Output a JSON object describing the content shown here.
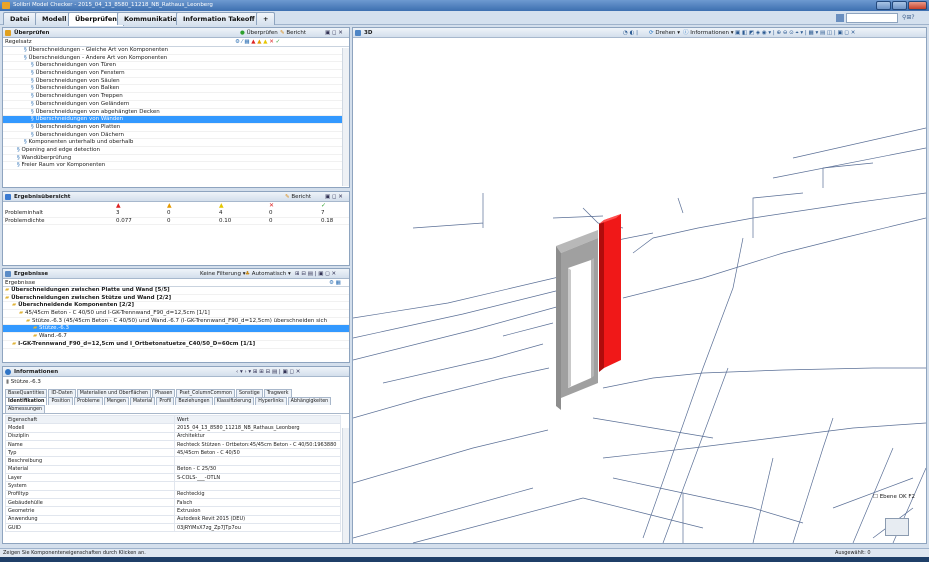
{
  "title": "Solibri Model Checker - 2015_04_13_8580_11218_NB_Rathaus_Leonberg",
  "tabs": [
    "Datei",
    "Modell",
    "Überprüfen",
    "Kommunikation",
    "Information Takeoff",
    "+"
  ],
  "active_tab": 2,
  "search_placeholder": "",
  "check_panel": {
    "title": "Überprüfen",
    "run_label": "Überprüfen",
    "report_label": "Bericht",
    "column_header": "Regelsatz",
    "rows": [
      {
        "indent": 3,
        "label": "Überschneidungen - Gleiche Art von Komponenten"
      },
      {
        "indent": 3,
        "label": "Überschneidungen - Andere Art von Komponenten"
      },
      {
        "indent": 4,
        "label": "Überschneidungen von Türen"
      },
      {
        "indent": 4,
        "label": "Überschneidungen von Fenstern"
      },
      {
        "indent": 4,
        "label": "Überschneidungen von Säulen"
      },
      {
        "indent": 4,
        "label": "Überschneidungen von Balken"
      },
      {
        "indent": 4,
        "label": "Überschneidungen von Treppen"
      },
      {
        "indent": 4,
        "label": "Überschneidungen von Geländern"
      },
      {
        "indent": 4,
        "label": "Überschneidungen von abgehängten Decken"
      },
      {
        "indent": 4,
        "label": "Überschneidungen von Wänden"
      },
      {
        "indent": 4,
        "label": "Überschneidungen von Platten"
      },
      {
        "indent": 4,
        "label": "Überschneidungen von Dächern"
      },
      {
        "indent": 3,
        "label": "Komponenten unterhalb und oberhalb"
      },
      {
        "indent": 2,
        "label": "Opening and edge detection"
      },
      {
        "indent": 2,
        "label": "Wandüberprüfung"
      },
      {
        "indent": 2,
        "label": "Freier Raum vor Komponenten"
      }
    ],
    "selected_row": 9
  },
  "summary_panel": {
    "title": "Ergebnisübersicht",
    "report_label": "Bericht",
    "rows": [
      {
        "label": "Probleminhalt",
        "values": [
          "3",
          "0",
          "4",
          "0",
          "7"
        ]
      },
      {
        "label": "Problemdichte",
        "values": [
          "0.077",
          "0",
          "0.10",
          "0",
          "0.18"
        ]
      }
    ]
  },
  "results_panel": {
    "title": "Ergebnisse",
    "filter_label": "Keine Filterung",
    "auto_label": "Automatisch",
    "column_header": "Ergebnisse",
    "rows": [
      {
        "indent": 0,
        "label": "Überschneidungen zwischen Platte und Wand [5/5]",
        "bold": true
      },
      {
        "indent": 0,
        "label": "Überschneidungen zwischen Stütze und Wand [2/2]",
        "bold": true
      },
      {
        "indent": 1,
        "label": "Überschneidende Komponenten [2/2]",
        "bold": true
      },
      {
        "indent": 2,
        "label": "45/45cm Beton - C 40/50 und I-GK-Trennwand_F90_d=12,5cm [1/1]",
        "bold": false
      },
      {
        "indent": 3,
        "label": "Stütze.-6.3 (45/45cm Beton - C 40/50) und Wand.-6.7 (I-GK-Trennwand_F90_d=12,5cm) überschneiden sich",
        "bold": false
      },
      {
        "indent": 4,
        "label": "Stütze.-6.3",
        "bold": false
      },
      {
        "indent": 4,
        "label": "Wand.-6.7",
        "bold": false
      },
      {
        "indent": 1,
        "label": "I-GK-Trennwand_F90_d=12,5cm und I_Ortbetonstuetze_C40/50_D=60cm [1/1]",
        "bold": true
      }
    ],
    "selected_row": 5
  },
  "info_panel": {
    "title": "Informationen",
    "subject": "Stütze.-6.3",
    "tabs_row1": [
      "BaseQuantities",
      "ID-Daten",
      "Materialien und Oberflächen",
      "Phasen",
      "Pset_ColumnCommon",
      "Sonstige",
      "Tragwerk"
    ],
    "tabs_row2": [
      "Identifikation",
      "Position",
      "Probleme",
      "Mengen",
      "Material",
      "Profil",
      "Beziehungen",
      "Klassifizierung",
      "Hyperlinks",
      "Abhängigkeiten",
      "Abmessungen"
    ],
    "active_tab2": 0,
    "headers": [
      "Eigenschaft",
      "Wert"
    ],
    "rows": [
      [
        "Modell",
        "2015_04_13_8580_11218_NB_Rathaus_Leonberg"
      ],
      [
        "Disziplin",
        "Architektur"
      ],
      [
        "Name",
        "Rechteck Stützen - Ortbeton:45/45cm Beton - C 40/50:1963880"
      ],
      [
        "Typ",
        "45/45cm Beton - C 40/50"
      ],
      [
        "Beschreibung",
        ""
      ],
      [
        "Material",
        "Beton - C 25/30"
      ],
      [
        "Layer",
        "S-COLS-___-OTLN"
      ],
      [
        "System",
        ""
      ],
      [
        "Profiltyp",
        "Rechteckig"
      ],
      [
        "Gebäudehülle",
        "Falsch"
      ],
      [
        "Geometrie",
        "Extrusion"
      ],
      [
        "Anwendung",
        "Autodesk Revit 2015 (DEU)"
      ],
      [
        "GUID",
        "03jRYiMsX7zg_Zp7JTp7ou"
      ]
    ]
  },
  "view3d": {
    "title": "3D",
    "rotate_label": "Drehen",
    "info_label": "Informationen",
    "floor_label": "Ebene OK F2"
  },
  "status": {
    "left": "Zeigen Sie Komponenteneigenschaften durch Klicken an.",
    "right": "Ausgewählt: 0"
  },
  "colors": {
    "accent": "#3399ff",
    "highlight": "#e01010",
    "check": "#2ea02e",
    "error": "#d22222"
  }
}
